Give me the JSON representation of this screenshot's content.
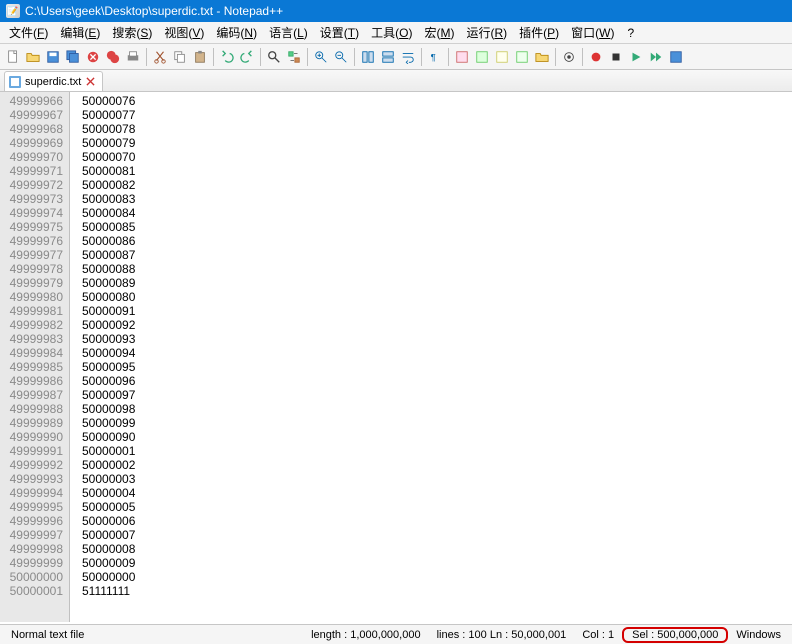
{
  "title": "C:\\Users\\geek\\Desktop\\superdic.txt - Notepad++",
  "menu": [
    {
      "label": "文件",
      "key": "F"
    },
    {
      "label": "编辑",
      "key": "E"
    },
    {
      "label": "搜索",
      "key": "S"
    },
    {
      "label": "视图",
      "key": "V"
    },
    {
      "label": "编码",
      "key": "N"
    },
    {
      "label": "语言",
      "key": "L"
    },
    {
      "label": "设置",
      "key": "T"
    },
    {
      "label": "工具",
      "key": "O"
    },
    {
      "label": "宏",
      "key": "M"
    },
    {
      "label": "运行",
      "key": "R"
    },
    {
      "label": "插件",
      "key": "P"
    },
    {
      "label": "窗口",
      "key": "W"
    }
  ],
  "help_label": "?",
  "tab": {
    "name": "superdic.txt"
  },
  "lines": [
    {
      "n": "49999966",
      "v": "50000076"
    },
    {
      "n": "49999967",
      "v": "50000077"
    },
    {
      "n": "49999968",
      "v": "50000078"
    },
    {
      "n": "49999969",
      "v": "50000079"
    },
    {
      "n": "49999970",
      "v": "50000070"
    },
    {
      "n": "49999971",
      "v": "50000081"
    },
    {
      "n": "49999972",
      "v": "50000082"
    },
    {
      "n": "49999973",
      "v": "50000083"
    },
    {
      "n": "49999974",
      "v": "50000084"
    },
    {
      "n": "49999975",
      "v": "50000085"
    },
    {
      "n": "49999976",
      "v": "50000086"
    },
    {
      "n": "49999977",
      "v": "50000087"
    },
    {
      "n": "49999978",
      "v": "50000088"
    },
    {
      "n": "49999979",
      "v": "50000089"
    },
    {
      "n": "49999980",
      "v": "50000080"
    },
    {
      "n": "49999981",
      "v": "50000091"
    },
    {
      "n": "49999982",
      "v": "50000092"
    },
    {
      "n": "49999983",
      "v": "50000093"
    },
    {
      "n": "49999984",
      "v": "50000094"
    },
    {
      "n": "49999985",
      "v": "50000095"
    },
    {
      "n": "49999986",
      "v": "50000096"
    },
    {
      "n": "49999987",
      "v": "50000097"
    },
    {
      "n": "49999988",
      "v": "50000098"
    },
    {
      "n": "49999989",
      "v": "50000099"
    },
    {
      "n": "49999990",
      "v": "50000090"
    },
    {
      "n": "49999991",
      "v": "50000001"
    },
    {
      "n": "49999992",
      "v": "50000002"
    },
    {
      "n": "49999993",
      "v": "50000003"
    },
    {
      "n": "49999994",
      "v": "50000004"
    },
    {
      "n": "49999995",
      "v": "50000005"
    },
    {
      "n": "49999996",
      "v": "50000006"
    },
    {
      "n": "49999997",
      "v": "50000007"
    },
    {
      "n": "49999998",
      "v": "50000008"
    },
    {
      "n": "49999999",
      "v": "50000009"
    },
    {
      "n": "50000000",
      "v": "50000000"
    },
    {
      "n": "50000001",
      "v": "51111111"
    }
  ],
  "status": {
    "filetype": "Normal text file",
    "length_label": "length :",
    "length_value": "1,000,000,000",
    "lines_label": "lines :",
    "lines_value": "100",
    "ln_label": "Ln :",
    "ln_value": "50,000,001",
    "col_label": "Col :",
    "col_value": "1",
    "sel_label": "Sel :",
    "sel_value": "500,000,000",
    "eol": "Windows"
  }
}
